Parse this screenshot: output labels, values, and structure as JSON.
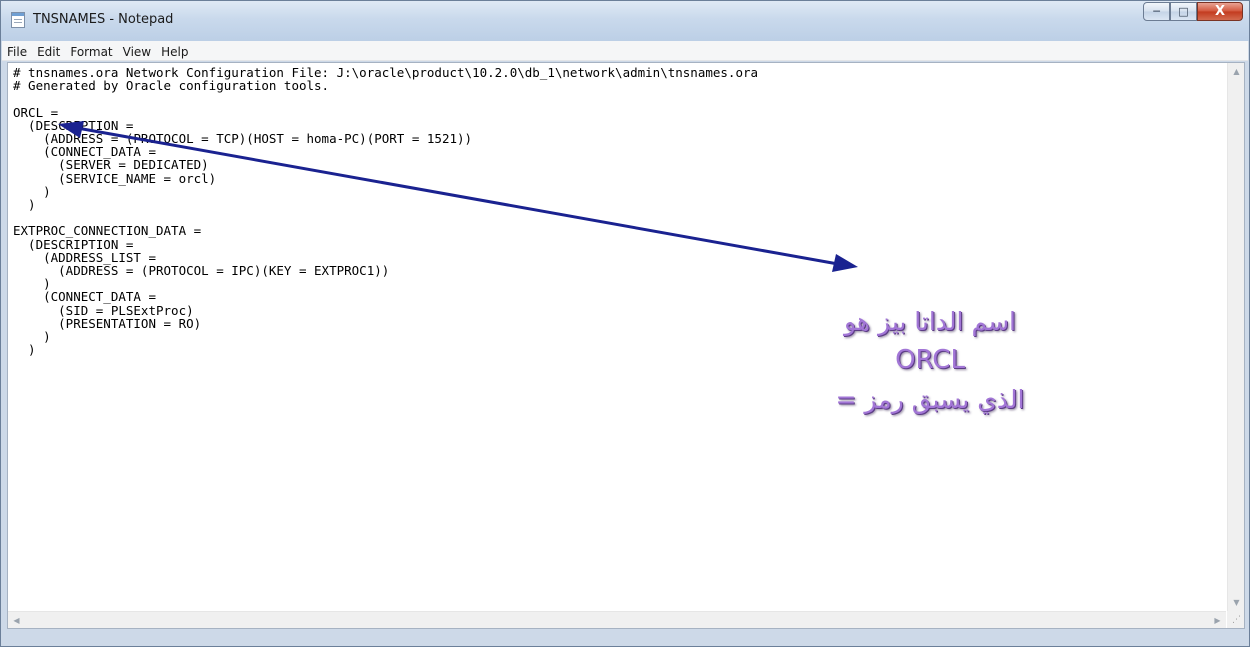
{
  "window": {
    "title": "TNSNAMES - Notepad",
    "icon": "notepad-icon",
    "controls": {
      "minimize": "─",
      "maximize": "□",
      "close": "X"
    }
  },
  "menu": [
    "File",
    "Edit",
    "Format",
    "View",
    "Help"
  ],
  "editor": {
    "lines": [
      "# tnsnames.ora Network Configuration File: J:\\oracle\\product\\10.2.0\\db_1\\network\\admin\\tnsnames.ora",
      "# Generated by Oracle configuration tools.",
      "",
      "ORCL =",
      "  (DESCRIPTION =",
      "    (ADDRESS = (PROTOCOL = TCP)(HOST = homa-PC)(PORT = 1521))",
      "    (CONNECT_DATA =",
      "      (SERVER = DEDICATED)",
      "      (SERVICE_NAME = orcl)",
      "    )",
      "  )",
      "",
      "EXTPROC_CONNECTION_DATA =",
      "  (DESCRIPTION =",
      "    (ADDRESS_LIST =",
      "      (ADDRESS = (PROTOCOL = IPC)(KEY = EXTPROC1))",
      "    )",
      "    (CONNECT_DATA =",
      "      (SID = PLSExtProc)",
      "      (PRESENTATION = RO)",
      "    )",
      "  )"
    ]
  },
  "scrollbars": {
    "up": "▲",
    "down": "▼",
    "left": "◀",
    "right": "▶",
    "grip": "⋰"
  },
  "annotation": {
    "line1": "اسم الداتا بيز هو",
    "line2": "ORCL",
    "line3": "الذي يسبق رمز =",
    "text_color": "#a276d6",
    "arrow_color": "#1a2290"
  }
}
